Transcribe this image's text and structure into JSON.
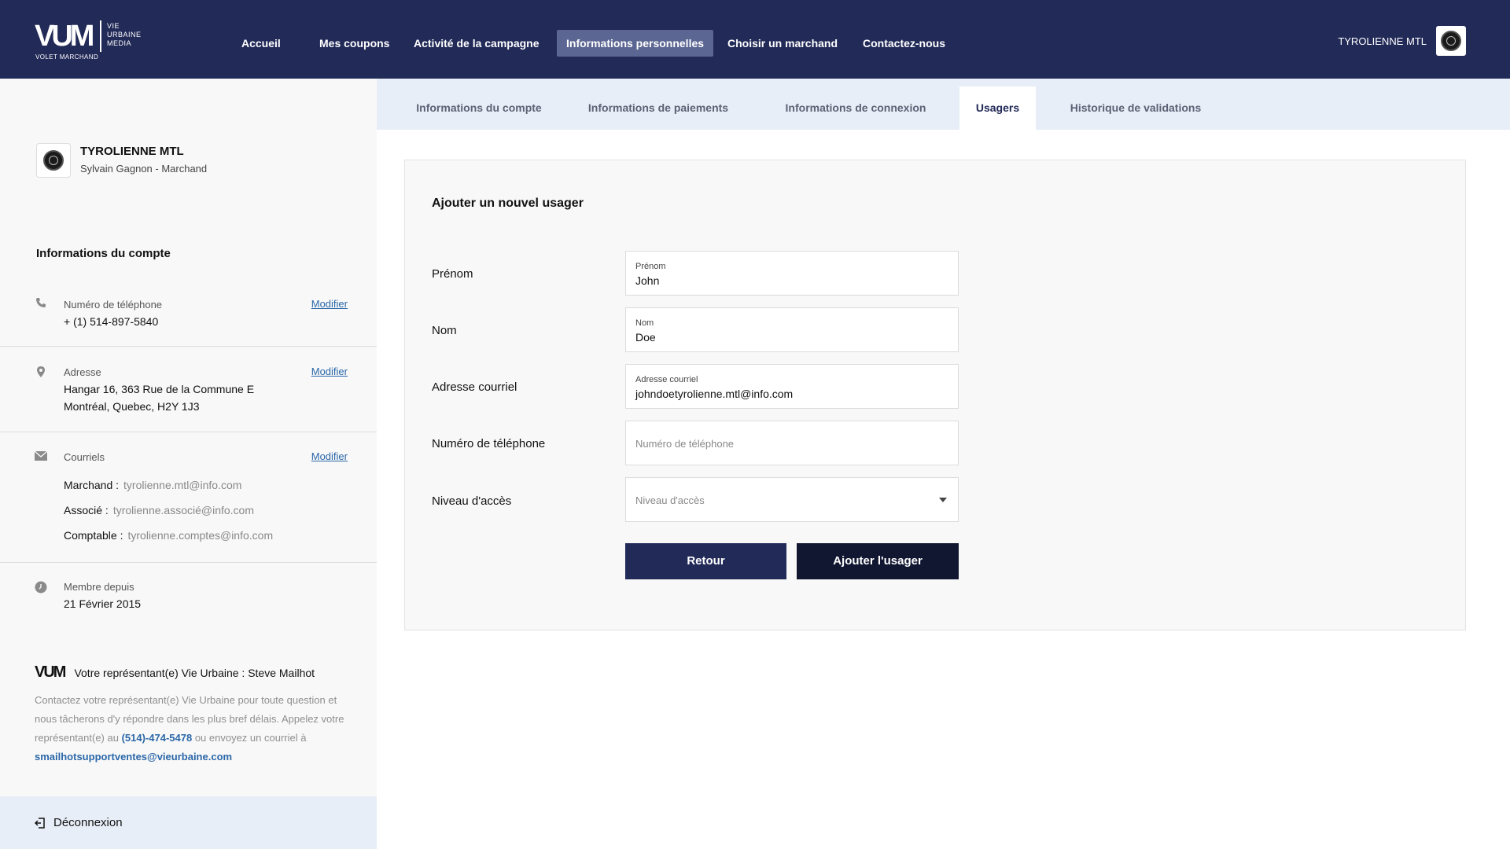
{
  "brand": {
    "mark": "VUM",
    "side_lines": [
      "VIE",
      "URBAINE",
      "MEDIA"
    ],
    "subtitle": "VOLET MARCHAND"
  },
  "nav": {
    "items": [
      {
        "label": "Accueil"
      },
      {
        "label": "Mes coupons"
      },
      {
        "label": "Activité de la campagne"
      },
      {
        "label": "Informations personnelles",
        "active": true
      },
      {
        "label": "Choisir un marchand"
      },
      {
        "label": "Contactez-nous"
      }
    ],
    "user_name": "TYROLIENNE MTL"
  },
  "sidebar": {
    "merchant_name": "TYROLIENNE MTL",
    "merchant_sub": "Sylvain Gagnon - Marchand",
    "section_title": "Informations du compte",
    "phone": {
      "label": "Numéro de téléphone",
      "value": "+ (1) 514-897-5840",
      "action": "Modifier",
      "icon": "phone-icon"
    },
    "address": {
      "label": "Adresse",
      "line1": "Hangar 16, 363 Rue de la Commune E",
      "line2": "Montréal, Quebec, H2Y 1J3",
      "action": "Modifier",
      "icon": "location-pin-icon"
    },
    "emails": {
      "label": "Courriels",
      "action": "Modifier",
      "icon": "envelope-icon",
      "rows": [
        {
          "key": "Marchand :",
          "value": "tyrolienne.mtl@info.com"
        },
        {
          "key": "Associé :",
          "value": "tyrolienne.associé@info.com"
        },
        {
          "key": "Comptable :",
          "value": "tyrolienne.comptes@info.com"
        }
      ]
    },
    "member": {
      "label": "Membre depuis",
      "value": "21 Février 2015",
      "icon": "clock-icon"
    },
    "rep": {
      "logo": "VUM",
      "title": "Votre représentant(e) Vie Urbaine : Steve Mailhot",
      "text_a": "Contactez votre représentant(e) Vie Urbaine pour toute question et nous tâcherons d'y répondre dans les plus bref délais. Appelez votre représentant(e) au ",
      "phone": "(514)-474-5478",
      "text_b": " ou envoyez un courriel à ",
      "email": "smailhotsupportventes@vieurbaine.com"
    },
    "logout": "Déconnexion"
  },
  "subtabs": [
    {
      "label": "Informations du compte"
    },
    {
      "label": "Informations de paiements"
    },
    {
      "label": "Informations de connexion"
    },
    {
      "label": "Usagers",
      "active": true
    },
    {
      "label": "Historique de validations"
    }
  ],
  "form": {
    "title": "Ajouter un nouvel usager",
    "first_name": {
      "label": "Prénom",
      "float": "Prénom",
      "value": "John"
    },
    "last_name": {
      "label": "Nom",
      "float": "Nom",
      "value": "Doe"
    },
    "email": {
      "label": "Adresse courriel",
      "float": "Adresse courriel",
      "value": "johndoetyrolienne.mtl@info.com"
    },
    "phone": {
      "label": "Numéro de téléphone",
      "placeholder": "Numéro de téléphone"
    },
    "access": {
      "label": "Niveau d'accès",
      "placeholder": "Niveau d'accès"
    },
    "back_button": "Retour",
    "submit_button": "Ajouter l'usager"
  },
  "colors": {
    "nav_bg": "#222a58",
    "nav_active": "#5c6693",
    "subtab_bg": "#e8eef7",
    "link": "#2a67a8",
    "btn_back": "#222a58",
    "btn_submit": "#111631"
  }
}
